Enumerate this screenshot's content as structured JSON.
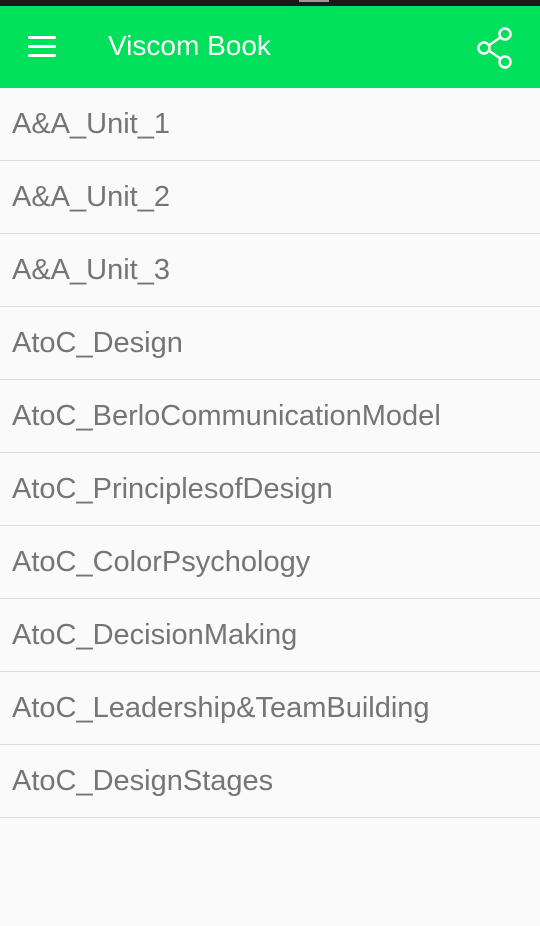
{
  "app": {
    "title": "Viscom Book",
    "accent_color": "#00e05a",
    "menu_icon": "hamburger-menu-icon",
    "share_icon": "share-icon"
  },
  "list": {
    "items": [
      {
        "label": "A&A_Unit_1"
      },
      {
        "label": "A&A_Unit_2"
      },
      {
        "label": "A&A_Unit_3"
      },
      {
        "label": "AtoC_Design"
      },
      {
        "label": "AtoC_BerloCommunicationModel"
      },
      {
        "label": "AtoC_PrinciplesofDesign"
      },
      {
        "label": "AtoC_ColorPsychology"
      },
      {
        "label": "AtoC_DecisionMaking"
      },
      {
        "label": "AtoC_Leadership&TeamBuilding"
      },
      {
        "label": "AtoC_DesignStages"
      }
    ]
  }
}
